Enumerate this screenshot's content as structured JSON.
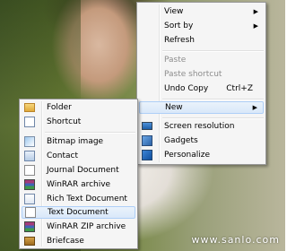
{
  "context_menu": {
    "items": [
      {
        "label": "View",
        "has_submenu": true
      },
      {
        "label": "Sort by",
        "has_submenu": true
      },
      {
        "label": "Refresh"
      },
      {
        "label": "Paste",
        "disabled": true
      },
      {
        "label": "Paste shortcut",
        "disabled": true
      },
      {
        "label": "Undo Copy",
        "shortcut": "Ctrl+Z"
      },
      {
        "label": "New",
        "has_submenu": true,
        "highlighted": true
      },
      {
        "label": "Screen resolution"
      },
      {
        "label": "Gadgets"
      },
      {
        "label": "Personalize"
      }
    ]
  },
  "new_submenu": {
    "items": [
      {
        "label": "Folder",
        "icon": "folder-icon"
      },
      {
        "label": "Shortcut",
        "icon": "shortcut-icon"
      },
      {
        "label": "Bitmap image",
        "icon": "bitmap-icon"
      },
      {
        "label": "Contact",
        "icon": "contact-icon"
      },
      {
        "label": "Journal Document",
        "icon": "journal-icon"
      },
      {
        "label": "WinRAR archive",
        "icon": "winrar-icon"
      },
      {
        "label": "Rich Text Document",
        "icon": "rtf-icon"
      },
      {
        "label": "Text Document",
        "icon": "text-document-icon",
        "highlighted": true
      },
      {
        "label": "WinRAR ZIP archive",
        "icon": "winrar-zip-icon"
      },
      {
        "label": "Briefcase",
        "icon": "briefcase-icon"
      }
    ]
  },
  "watermark": "www.sanlo.com",
  "colors": {
    "highlight_border": "#aecff7",
    "highlight_fill": "#d9e8f9",
    "menu_bg": "#f5f5f5"
  }
}
